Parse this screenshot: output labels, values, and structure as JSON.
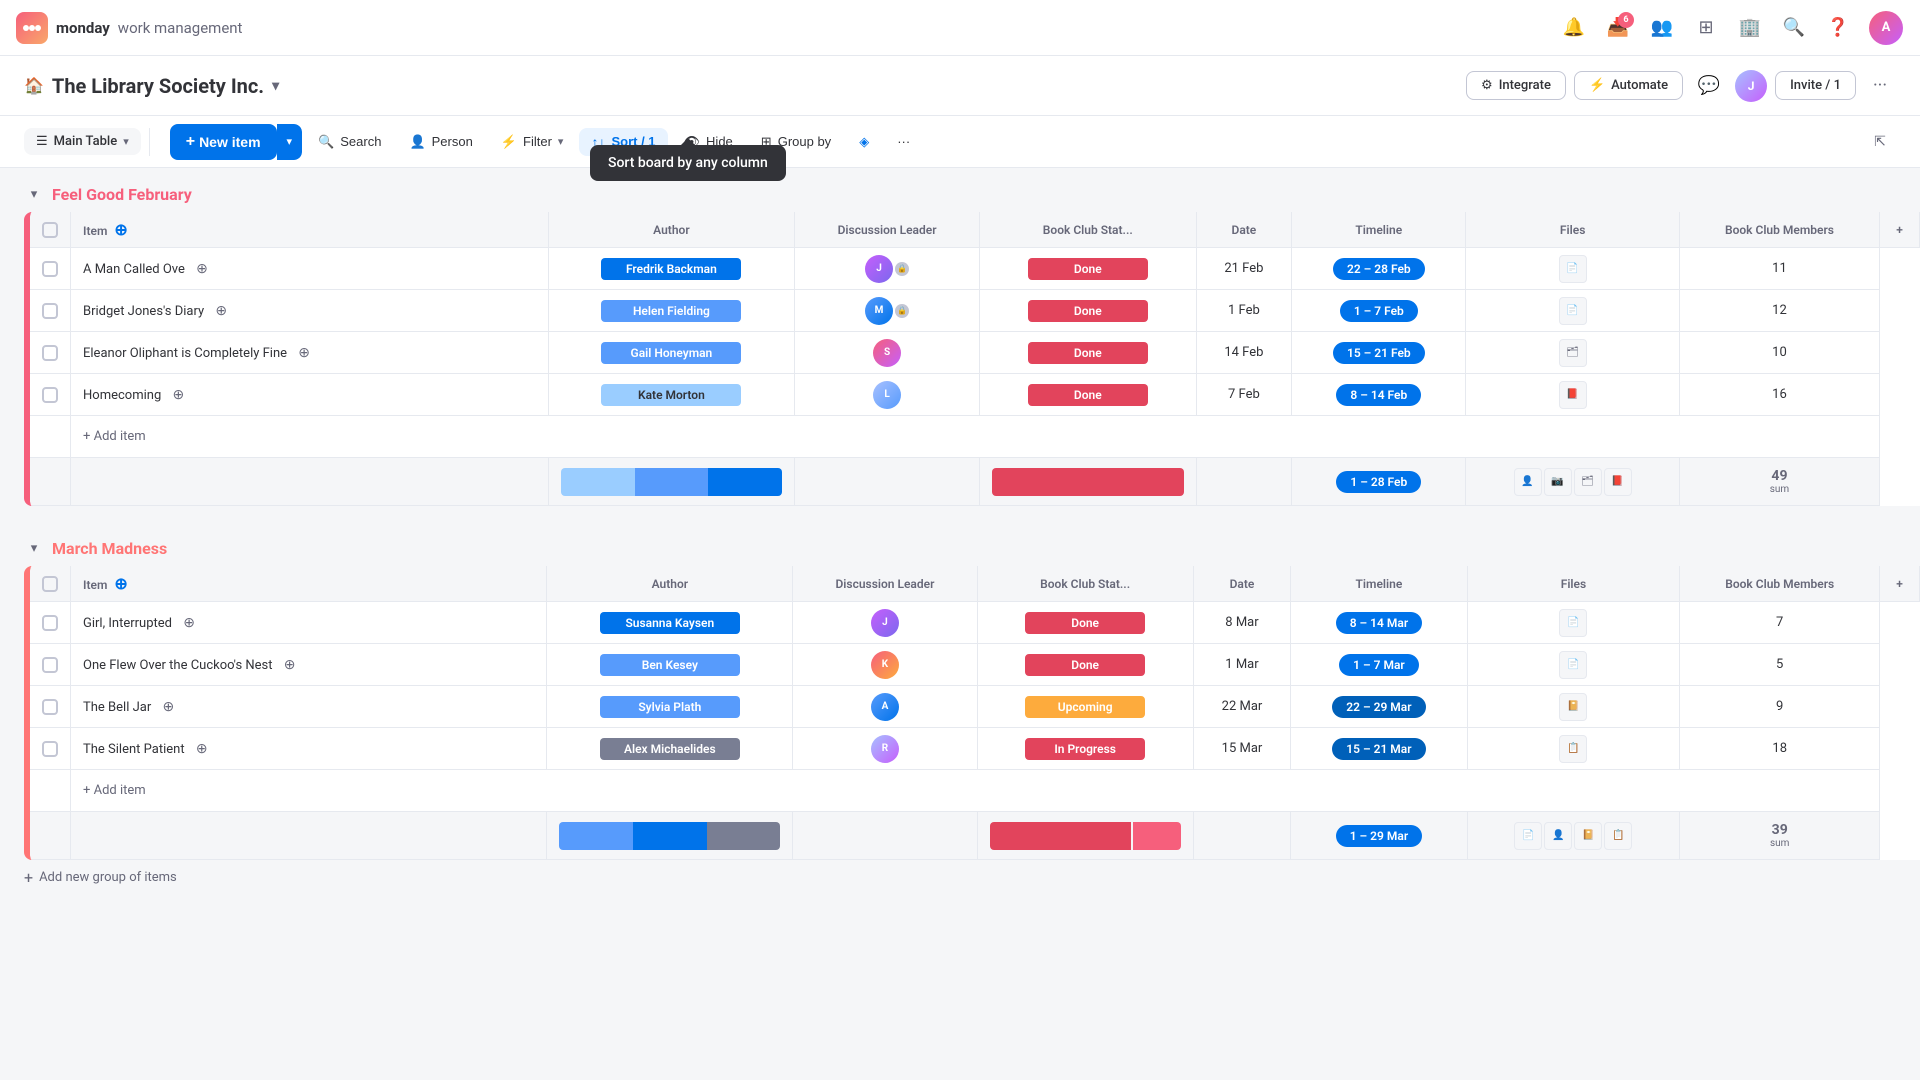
{
  "brand": {
    "logo_text": "M",
    "name": "monday",
    "tagline": "work management"
  },
  "nav": {
    "notification_count": "6",
    "invite_label": "Invite / 1"
  },
  "workspace": {
    "title": "The Library Society Inc.",
    "integrate_label": "Integrate",
    "automate_label": "Automate"
  },
  "actionbar": {
    "main_table_label": "Main Table",
    "new_item_label": "New item",
    "search_label": "Search",
    "person_label": "Person",
    "filter_label": "Filter",
    "sort_label": "Sort / 1",
    "hide_label": "Hide",
    "group_by_label": "Group by"
  },
  "tooltip": {
    "text": "Sort board by any column"
  },
  "group1": {
    "title": "Feel Good February",
    "color": "pink",
    "columns": [
      "Item",
      "Author",
      "Discussion Leader",
      "Book Club Stat...",
      "Date",
      "Timeline",
      "Files",
      "Book Club Members"
    ],
    "rows": [
      {
        "item": "A Man Called Ove",
        "author": "Fredrik Backman",
        "author_style": "dark",
        "date": "21 Feb",
        "timeline": "22 – 28 Feb",
        "status": "Done",
        "members": "11"
      },
      {
        "item": "Bridget Jones's Diary",
        "author": "Helen Fielding",
        "author_style": "medium",
        "date": "1 Feb",
        "timeline": "1 – 7 Feb",
        "status": "Done",
        "members": "12"
      },
      {
        "item": "Eleanor Oliphant is Completely Fine",
        "author": "Gail Honeyman",
        "author_style": "medium",
        "date": "14 Feb",
        "timeline": "15 – 21 Feb",
        "status": "Done",
        "members": "10"
      },
      {
        "item": "Homecoming",
        "author": "Kate Morton",
        "author_style": "light",
        "date": "7 Feb",
        "timeline": "8 – 14 Feb",
        "status": "Done",
        "members": "16"
      }
    ],
    "add_item_label": "+ Add item",
    "summary_timeline": "1 – 28 Feb",
    "summary_members": "49",
    "summary_sum": "sum"
  },
  "group2": {
    "title": "March Madness",
    "color": "orange",
    "columns": [
      "Item",
      "Author",
      "Discussion Leader",
      "Book Club Stat...",
      "Date",
      "Timeline",
      "Files",
      "Book Club Members"
    ],
    "rows": [
      {
        "item": "Girl, Interrupted",
        "author": "Susanna Kaysen",
        "author_style": "dark",
        "date": "8 Mar",
        "timeline": "8 – 14 Mar",
        "status": "Done",
        "members": "7"
      },
      {
        "item": "One Flew Over the Cuckoo's Nest",
        "author": "Ben Kesey",
        "author_style": "medium",
        "date": "1 Mar",
        "timeline": "1 – 7 Mar",
        "status": "Done",
        "members": "5"
      },
      {
        "item": "The Bell Jar",
        "author": "Sylvia Plath",
        "author_style": "medium",
        "date": "22 Mar",
        "timeline": "22 – 29 Mar",
        "status": "Upcoming",
        "members": "9"
      },
      {
        "item": "The Silent Patient",
        "author": "Alex Michaelides",
        "author_style": "gray",
        "date": "15 Mar",
        "timeline": "15 – 21 Mar",
        "status": "In Progress",
        "members": "18"
      }
    ],
    "add_item_label": "+ Add item",
    "summary_timeline": "1 – 29 Mar",
    "summary_members": "39",
    "summary_sum": "sum"
  }
}
